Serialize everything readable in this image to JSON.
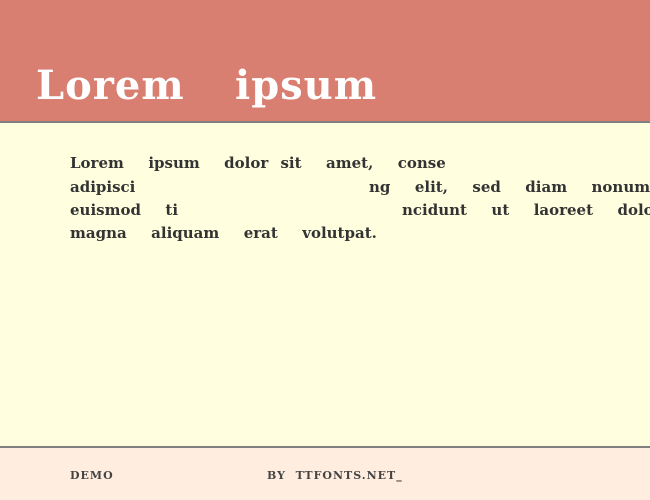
{
  "header": {
    "title_part1": "Lorem",
    "title_part2": "ipsum"
  },
  "body": {
    "line1": "Lorem  ipsum  dolor sit  amet,  conse",
    "line2a": "adipisci",
    "line2b": "ng  elit,  sed  diam  nonummy",
    "line3a": "euismod  ti",
    "line3b": "ncidunt  ut  laoreet  dolor",
    "line4": "magna  aliquam  erat  volutpat."
  },
  "footer": {
    "left": "DEMO",
    "right": "BY  TTFONTS.NET_"
  },
  "colors": {
    "header": "#d97f72",
    "body": "#ffffdf",
    "footer": "#ffeedf"
  }
}
